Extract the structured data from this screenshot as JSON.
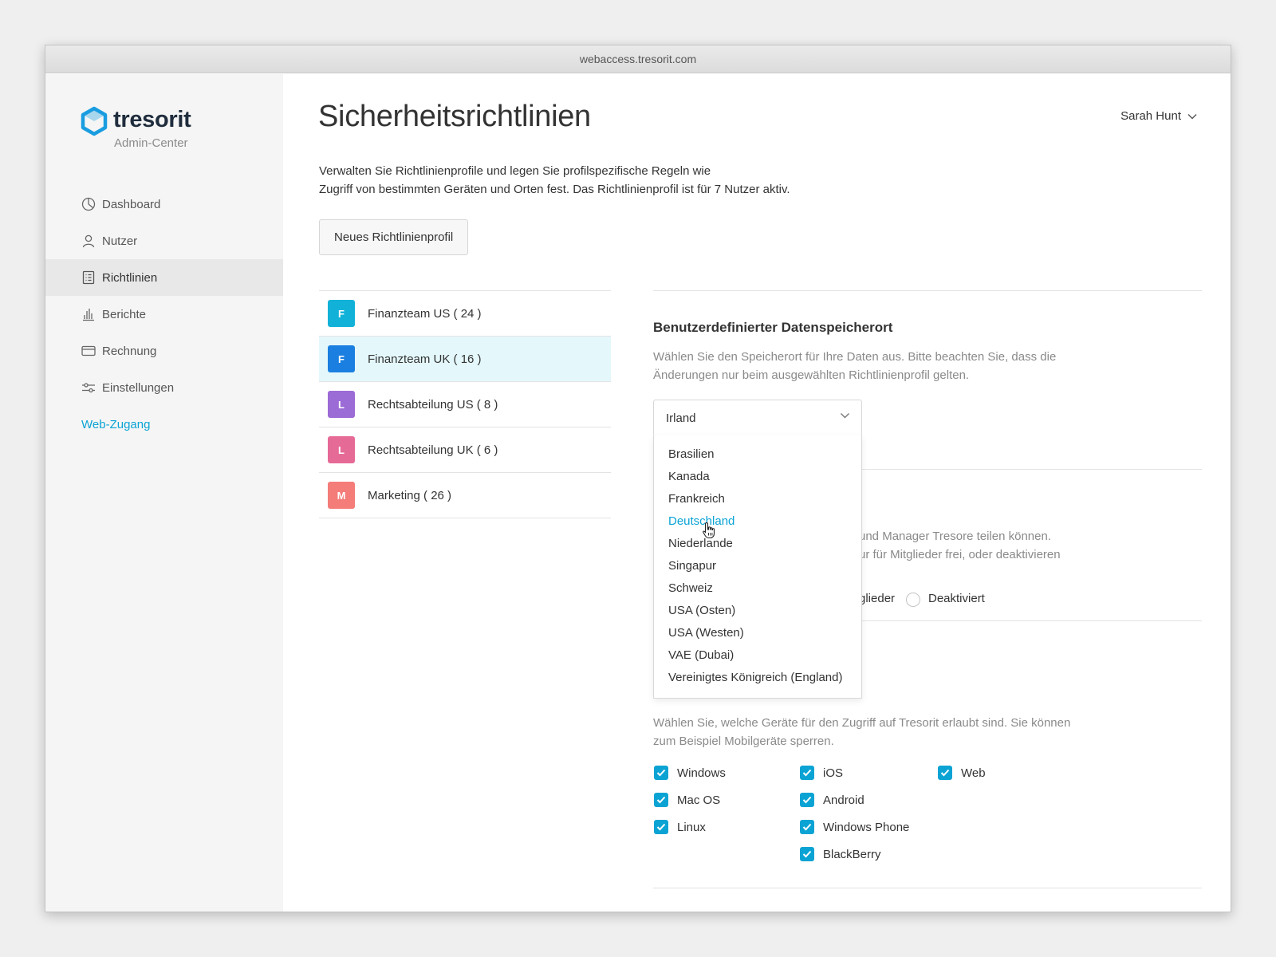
{
  "window": {
    "url": "webaccess.tresorit.com"
  },
  "brand": {
    "name": "tresorit",
    "subtitle": "Admin-Center"
  },
  "sidebar": {
    "items": [
      {
        "label": "Dashboard",
        "icon": "dashboard-icon"
      },
      {
        "label": "Nutzer",
        "icon": "user-icon"
      },
      {
        "label": "Richtlinien",
        "icon": "policy-icon",
        "active": true
      },
      {
        "label": "Berichte",
        "icon": "bar-chart-icon"
      },
      {
        "label": "Rechnung",
        "icon": "credit-card-icon"
      },
      {
        "label": "Einstellungen",
        "icon": "sliders-icon"
      }
    ],
    "web_access": "Web-Zugang"
  },
  "header": {
    "title": "Sicherheitsrichtlinien",
    "user": "Sarah Hunt",
    "intro_line1": "Verwalten Sie Richtlinienprofile und legen Sie profilspezifische Regeln wie",
    "intro_line2": "Zugriff von bestimmten Geräten und Orten fest. Das Richtlinienprofil ist für 7 Nutzer aktiv.",
    "new_profile_button": "Neues Richtlinienprofil"
  },
  "profiles": [
    {
      "initial": "F",
      "label": "Finanzteam US ( 24 )",
      "color": "#12b2d8"
    },
    {
      "initial": "F",
      "label": "Finanzteam UK ( 16 )",
      "color": "#1a7fe0",
      "selected": true
    },
    {
      "initial": "L",
      "label": "Rechtsabteilung US ( 8 )",
      "color": "#9b6bd6"
    },
    {
      "initial": "L",
      "label": "Rechtsabteilung UK ( 6 )",
      "color": "#e66a96"
    },
    {
      "initial": "M",
      "label": "Marketing ( 26 )",
      "color": "#f47c79"
    }
  ],
  "storage": {
    "title": "Benutzerdefinierter Datenspeicherort",
    "desc_line1": "Wählen Sie den Speicherort für Ihre Daten aus. Bitte beachten Sie, dass die",
    "desc_line2": "Änderungen nur beim ausgewählten Richtlinienprofil gelten.",
    "selected": "Irland",
    "options": [
      "Brasilien",
      "Kanada",
      "Frankreich",
      "Deutschland",
      "Niederlande",
      "Singapur",
      "Schweiz",
      "USA (Osten)",
      "USA (Westen)",
      "VAE (Dubai)",
      "Vereinigtes Königreich (England)"
    ],
    "hovered": "Deutschland"
  },
  "sharing": {
    "partial_line1": "und Manager Tresore teilen können.",
    "partial_line2": "ur für Mitglieder frei, oder deaktivieren",
    "radio_partial": "glieder",
    "radio_disabled": "Deaktiviert"
  },
  "devices": {
    "desc_line1": "Wählen Sie, welche Geräte für den Zugriff auf Tresorit erlaubt sind. Sie können",
    "desc_line2": "zum Beispiel Mobilgeräte sperren.",
    "col1": [
      "Windows",
      "Mac OS",
      "Linux"
    ],
    "col2": [
      "iOS",
      "Android",
      "Windows Phone",
      "BlackBerry"
    ],
    "col3": [
      "Web"
    ]
  },
  "colors": {
    "accent": "#0aa3d4",
    "selected_row": "#e4f8fc"
  }
}
